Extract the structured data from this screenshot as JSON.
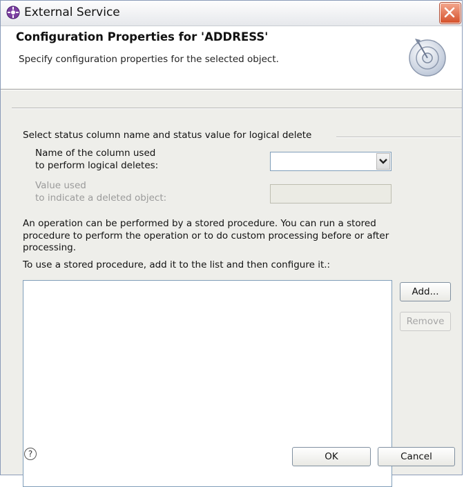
{
  "window": {
    "title": "External Service"
  },
  "header": {
    "title": "Configuration Properties for 'ADDRESS'",
    "description": "Specify configuration properties for the selected object."
  },
  "logical_delete": {
    "group_title": "Select status column name and status value for logical delete",
    "column_label_line1": "Name of the column used",
    "column_label_line2": "to perform logical deletes:",
    "column_value": "",
    "value_label_line1": "Value used",
    "value_label_line2": "to indicate a deleted object:",
    "value_value": ""
  },
  "stored_procedure": {
    "paragraph_line1": "An operation can be performed by a stored procedure. You can run a stored",
    "paragraph_line2": "procedure to perform the operation or to do custom processing before or after",
    "paragraph_line3": "processing.",
    "instruction": "To use a stored procedure, add it to the list and then configure it.:",
    "items": [],
    "add_label": "Add...",
    "remove_label": "Remove"
  },
  "footer": {
    "help_symbol": "?",
    "ok_label": "OK",
    "cancel_label": "Cancel"
  },
  "icons": {
    "app": "service-gear-icon",
    "close": "close-icon",
    "banner": "wizard-banner-icon",
    "dropdown": "chevron-down-icon",
    "help": "help-icon"
  },
  "colors": {
    "close_button": "#d5522c",
    "app_icon": "#7b3fa0",
    "dialog_background": "#eeeeea",
    "input_border": "#7f9db9"
  }
}
